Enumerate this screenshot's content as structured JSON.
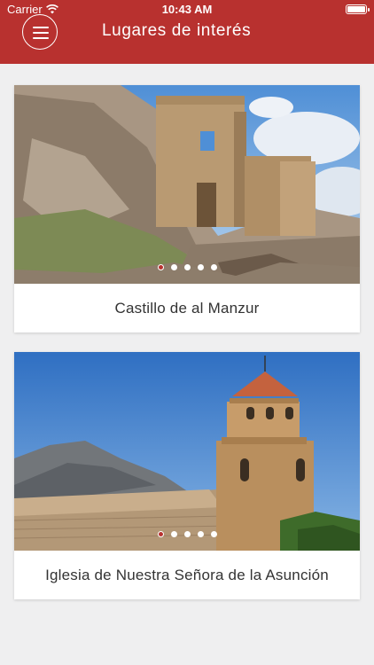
{
  "status": {
    "carrier": "Carrier",
    "time": "10:43 AM"
  },
  "header": {
    "title": "Lugares de interés"
  },
  "cards": [
    {
      "caption": "Castillo de al Manzur",
      "image_icon": "castle-ruins-photo",
      "dots": 5,
      "active_dot": 0
    },
    {
      "caption": "Iglesia de Nuestra Señora de la Asunción",
      "image_icon": "church-tower-photo",
      "dots": 5,
      "active_dot": 0
    }
  ],
  "colors": {
    "primary": "#b8312f",
    "background": "#efeff0"
  }
}
